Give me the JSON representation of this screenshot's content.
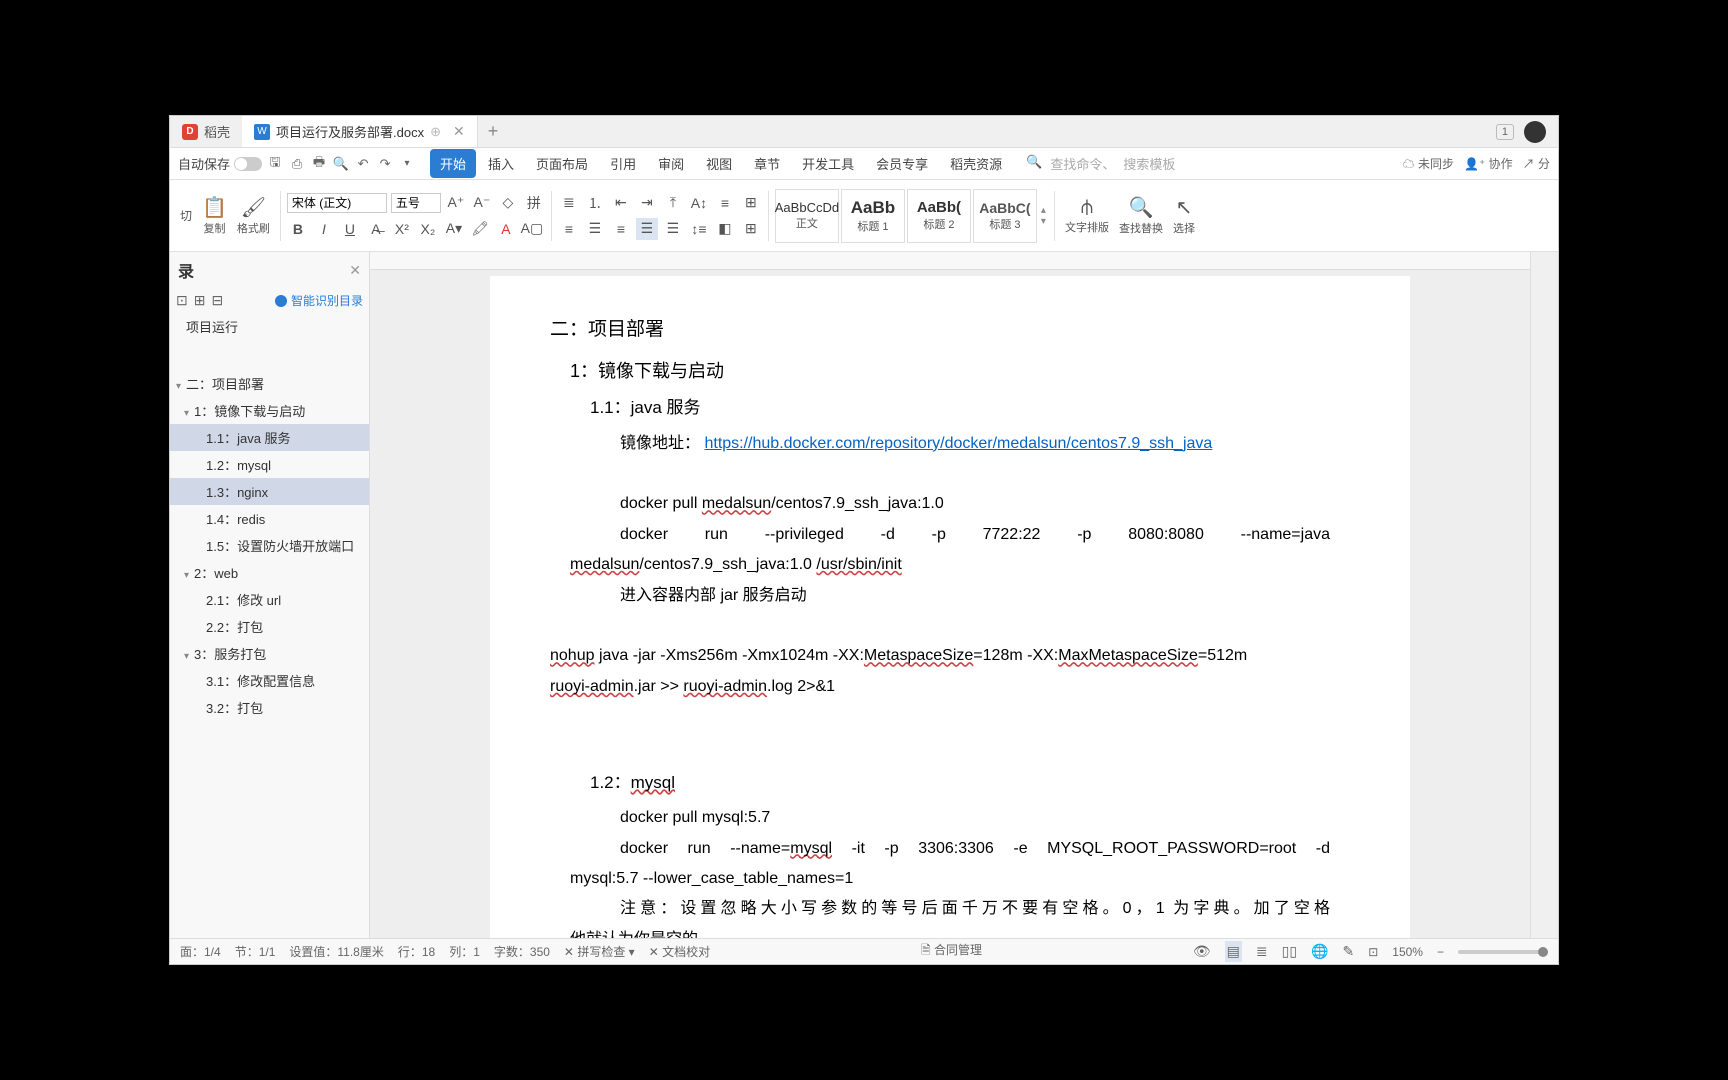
{
  "titlebar": {
    "app_name": "稻壳",
    "doc_name": "项目运行及服务部署.docx",
    "win_badge": "1"
  },
  "menubar": {
    "autosave": "自动保存",
    "tabs": [
      "开始",
      "插入",
      "页面布局",
      "引用",
      "审阅",
      "视图",
      "章节",
      "开发工具",
      "会员专享",
      "稻壳资源"
    ],
    "search_placeholder1": "查找命令、",
    "search_placeholder2": "搜索模板",
    "not_sync": "未同步",
    "collab": "协作",
    "share": "分"
  },
  "ribbon": {
    "cut": "切",
    "copy": "复制",
    "brush": "格式刷",
    "font_name": "宋体 (正文)",
    "font_size": "五号",
    "styles": [
      {
        "sample": "AaBbCcDd",
        "label": "正文"
      },
      {
        "sample": "AaBb",
        "label": "标题 1"
      },
      {
        "sample": "AaBb(",
        "label": "标题 2"
      },
      {
        "sample": "AaBbC(",
        "label": "标题 3"
      }
    ],
    "text_layout": "文字排版",
    "find_replace": "查找替换",
    "select": "选择"
  },
  "sidebar": {
    "title": "录",
    "smart_toc": "智能识别目录",
    "items": [
      {
        "level": 0,
        "label": "项目运行",
        "caret": false
      },
      {
        "level": 0,
        "label": "二：项目部署",
        "caret": true,
        "gap": true
      },
      {
        "level": 1,
        "label": "1：镜像下载与启动",
        "caret": true
      },
      {
        "level": 2,
        "label": "1.1：java 服务",
        "selected": true
      },
      {
        "level": 2,
        "label": "1.2：mysql"
      },
      {
        "level": 2,
        "label": "1.3：nginx",
        "selected": true
      },
      {
        "level": 2,
        "label": "1.4：redis"
      },
      {
        "level": 2,
        "label": "1.5：设置防火墙开放端口"
      },
      {
        "level": 1,
        "label": "2：web",
        "caret": true
      },
      {
        "level": 2,
        "label": "2.1：修改 url"
      },
      {
        "level": 2,
        "label": "2.2：打包"
      },
      {
        "level": 1,
        "label": "3：服务打包",
        "caret": true
      },
      {
        "level": 2,
        "label": "3.1：修改配置信息"
      },
      {
        "level": 2,
        "label": "3.2：打包"
      }
    ]
  },
  "doc": {
    "h_section": "二：项目部署",
    "h_1": "1：镜像下载与启动",
    "h_11": "1.1：java 服务",
    "mirror_label": "镜像地址：",
    "mirror_url": "https://hub.docker.com/repository/docker/medalsun/centos7.9_ssh_java",
    "pull_java_pre": "docker pull ",
    "pull_java_u": "medalsun",
    "pull_java_post": "/centos7.9_ssh_java:1.0",
    "run_java_l1": "docker    run    --privileged    -d    -p    7722:22    -p    8080:8080    --name=java",
    "run_java_l2a": "medalsun",
    "run_java_l2b": "/centos7.9_ssh_java:1.0    ",
    "run_java_l2c": "/usr/sbin/init",
    "enter_container": "进入容器内部 jar 服务启动",
    "nohup_a": "nohup",
    "nohup_b": " java -jar -Xms256m -Xmx1024m -XX:",
    "nohup_c": "MetaspaceSize",
    "nohup_d": "=128m -XX:",
    "nohup_e": "MaxMetaspaceSize",
    "nohup_f": "=512m",
    "nohup2_a": "ruoyi-admin",
    "nohup2_b": ".jar >> ",
    "nohup2_c": "ruoyi-admin",
    "nohup2_d": ".log 2>&1",
    "h_12": "1.2：mysql",
    "pull_mysql": "docker pull mysql:5.7",
    "run_mysql_l1": "docker  run  --name=mysql  -it  -p  3306:3306  -e  MYSQL_ROOT_PASSWORD=root  -d",
    "run_mysql_l2": "mysql:5.7 --lower_case_table_names=1",
    "note1": "注意：设置忽略大小写参数的等号后面千万不要有空格。0，1 为字典。加了空格",
    "note2": "他就认为你是空的"
  },
  "statusbar": {
    "page": "面：1/4",
    "section": "节：1/1",
    "pos": "设置值：11.8厘米",
    "row": "行：18",
    "col": "列：1",
    "words": "字数：350",
    "spellcheck": "拼写检查",
    "doccheck": "文档校对",
    "contract": "合同管理",
    "zoom": "150%"
  }
}
